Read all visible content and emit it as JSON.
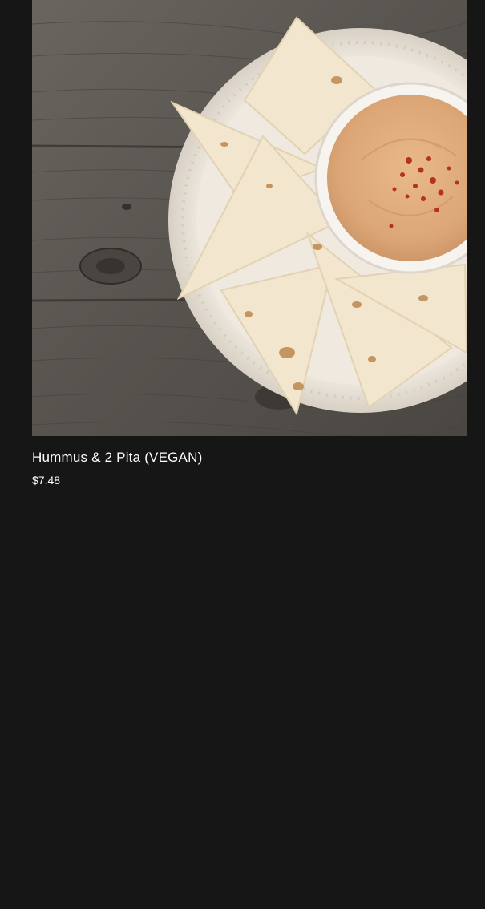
{
  "product": {
    "image_alt": "Hummus with pita wedges on a white plate over wooden boards",
    "name": "Hummus & 2 Pita (VEGAN)",
    "price": "$7.48"
  },
  "colors": {
    "page_background": "#161616",
    "text": "#ffffff"
  }
}
